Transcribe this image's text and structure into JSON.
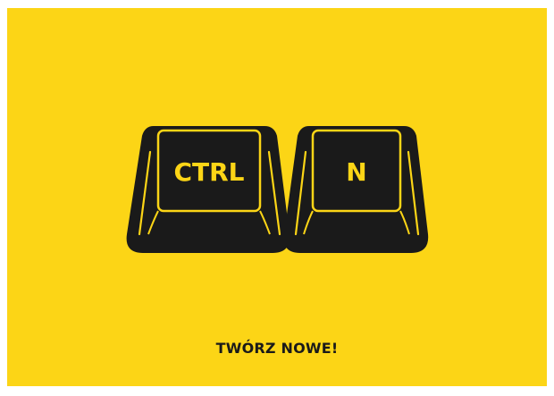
{
  "keys": [
    {
      "label": "CTRL",
      "icon": "keyboard-key-icon"
    },
    {
      "label": "N",
      "icon": "keyboard-key-icon"
    }
  ],
  "caption": "TWÓRZ NOWE!",
  "colors": {
    "background": "#fcd516",
    "key": "#1a1a1a",
    "key_label": "#fcd516",
    "caption": "#1a1a1a"
  }
}
